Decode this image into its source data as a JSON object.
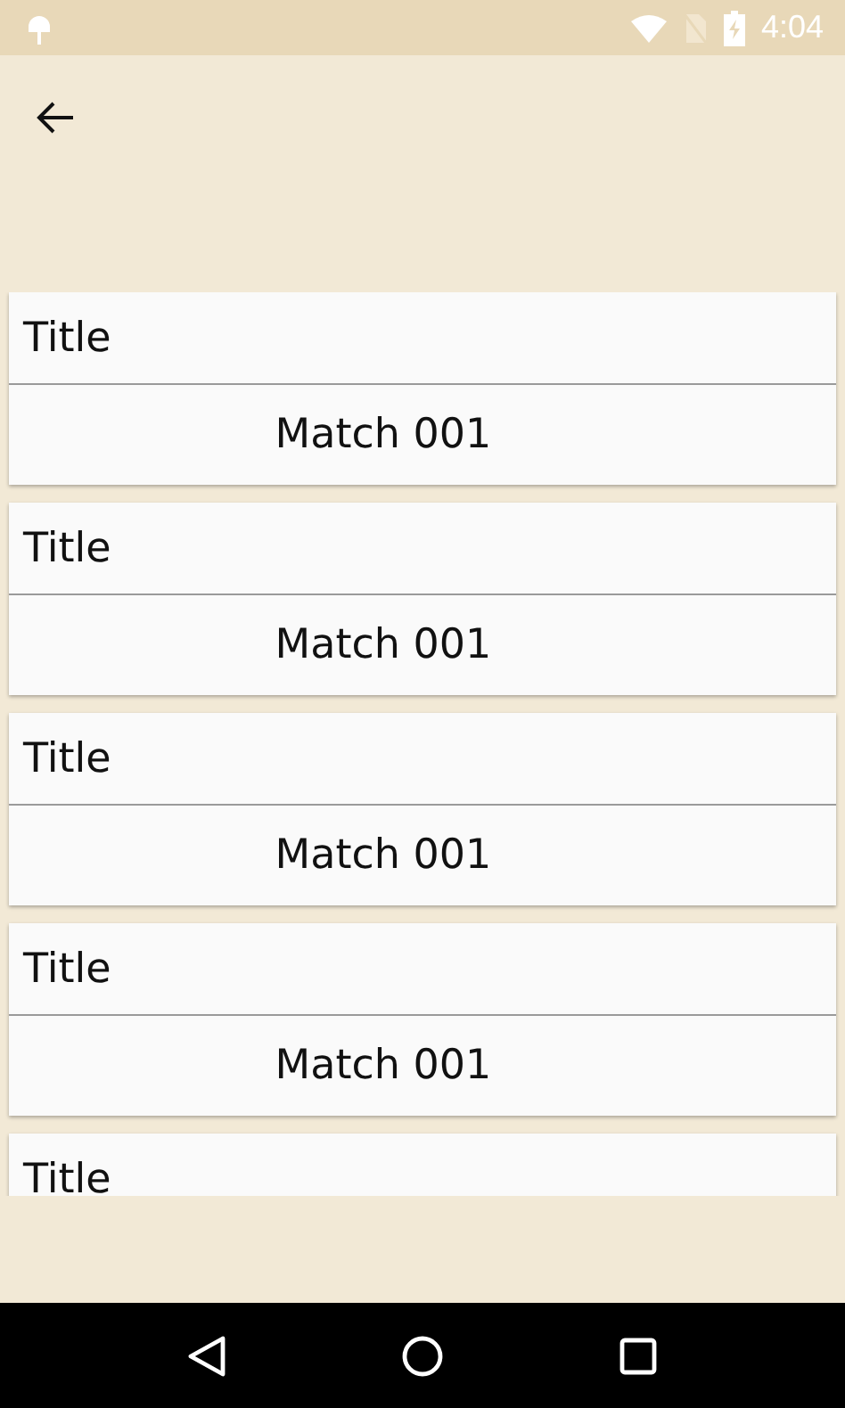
{
  "status_bar": {
    "time": "4:04"
  },
  "cards": [
    {
      "title": "Title",
      "match": "Match 001"
    },
    {
      "title": "Title",
      "match": "Match 001"
    },
    {
      "title": "Title",
      "match": "Match 001"
    },
    {
      "title": "Title",
      "match": "Match 001"
    },
    {
      "title": "Title"
    }
  ]
}
